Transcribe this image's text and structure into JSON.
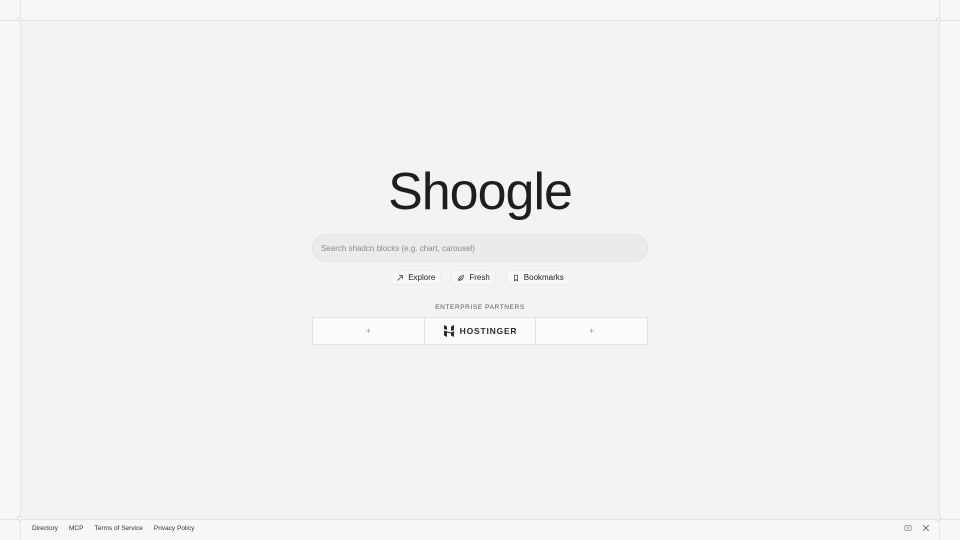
{
  "app": {
    "title": "Shoogle"
  },
  "search": {
    "placeholder": "Search shadcn blocks (e.g. chart, carousel)",
    "value": ""
  },
  "chips": [
    {
      "label": "Explore",
      "icon": "compass-arrow-icon"
    },
    {
      "label": "Fresh",
      "icon": "leaf-icon"
    },
    {
      "label": "Bookmarks",
      "icon": "bookmark-icon"
    }
  ],
  "partners": {
    "label": "ENTERPRISE PARTNERS",
    "left_placeholder": "+",
    "center_name": "HOSTINGER",
    "right_placeholder": "+"
  },
  "footer": {
    "links": [
      "Directory",
      "MCP",
      "Terms of Service",
      "Privacy Policy"
    ],
    "icons": [
      "card-icon",
      "x-logo-icon"
    ]
  }
}
